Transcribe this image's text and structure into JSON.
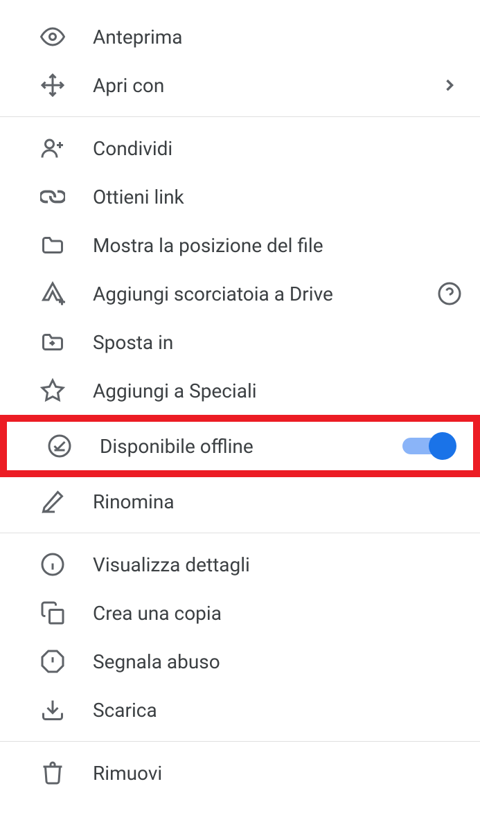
{
  "menu": {
    "group1": [
      {
        "label": "Anteprima",
        "has_submenu": false
      },
      {
        "label": "Apri con",
        "has_submenu": true
      }
    ],
    "group2": [
      {
        "label": "Condividi"
      },
      {
        "label": "Ottieni link"
      },
      {
        "label": "Mostra la posizione del file"
      },
      {
        "label": "Aggiungi scorciatoia a Drive",
        "has_help": true
      },
      {
        "label": "Sposta in"
      },
      {
        "label": "Aggiungi a Speciali"
      },
      {
        "label": "Disponibile offline",
        "toggle": true,
        "highlighted": true
      },
      {
        "label": "Rinomina"
      }
    ],
    "group3": [
      {
        "label": "Visualizza dettagli"
      },
      {
        "label": "Crea una copia"
      },
      {
        "label": "Segnala abuso"
      },
      {
        "label": "Scarica"
      }
    ],
    "group4": [
      {
        "label": "Rimuovi"
      }
    ]
  }
}
